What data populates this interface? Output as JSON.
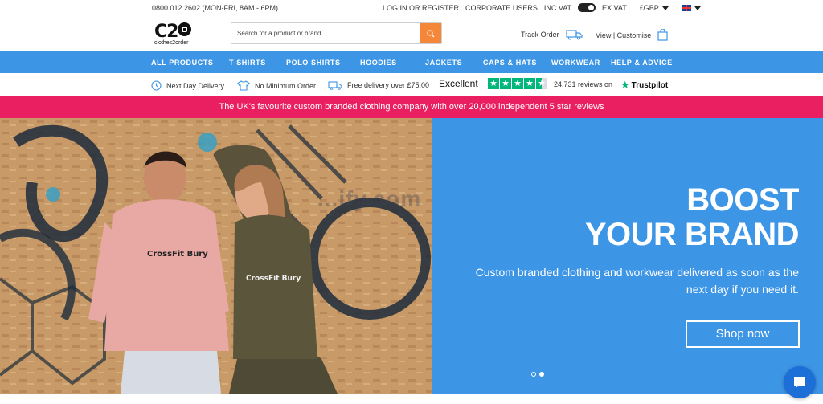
{
  "topbar": {
    "phone": "0800 012 2602 (MON-FRI, 8AM - 6PM).",
    "login": "LOG IN OR REGISTER",
    "corporate": "CORPORATE USERS",
    "inc_vat": "INC VAT",
    "ex_vat": "EX VAT",
    "currency": "£GBP"
  },
  "header": {
    "logo_text": "C2O",
    "logo_tagline": "clothes2order",
    "search_placeholder": "Search for a product or brand",
    "track_order": "Track Order",
    "basket_label": "View | Customise"
  },
  "nav": {
    "items": [
      "ALL PRODUCTS",
      "T-SHIRTS",
      "POLO SHIRTS",
      "HOODIES",
      "JACKETS",
      "CAPS & HATS",
      "WORKWEAR",
      "HELP & ADVICE"
    ]
  },
  "usp": {
    "next_day": "Next Day Delivery",
    "no_min": "No Minimum Order",
    "free_delivery": "Free delivery over £75.00",
    "excellent": "Excellent",
    "rating_stars": 4.5,
    "reviews": "24,731 reviews on",
    "trustpilot": "Trustpilot"
  },
  "promo": {
    "text": "The UK's favourite custom branded clothing company with over 20,000 independent 5 star reviews"
  },
  "hero": {
    "title_line1": "BOOST",
    "title_line2": "YOUR BRAND",
    "subtitle": "Custom branded clothing and workwear delivered as soon as the next day if you need it.",
    "cta": "Shop now",
    "hoodie_text": "CrossFit Bury",
    "watermark": "...ify.com",
    "slide_count": 2,
    "active_slide": 2
  },
  "colors": {
    "brand_blue": "#3d95e6",
    "promo_pink": "#ea1f62",
    "search_orange": "#f5873a",
    "trustpilot_green": "#00b67a"
  }
}
